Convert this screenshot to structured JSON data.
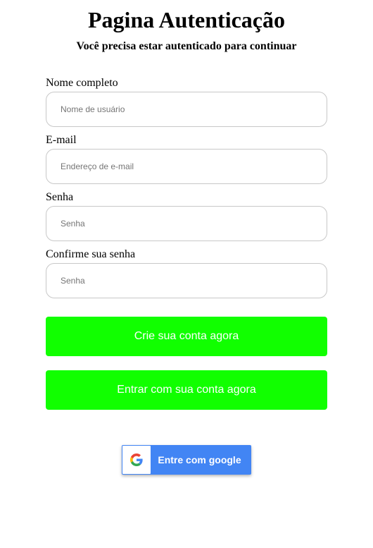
{
  "header": {
    "title": "Pagina Autenticação",
    "subtitle": "Você precisa estar autenticado para continuar"
  },
  "form": {
    "fields": [
      {
        "label": "Nome completo",
        "placeholder": "Nome de usuário",
        "value": ""
      },
      {
        "label": "E-mail",
        "placeholder": "Endereço de e-mail",
        "value": ""
      },
      {
        "label": "Senha",
        "placeholder": "Senha",
        "value": ""
      },
      {
        "label": "Confirme sua senha",
        "placeholder": "Senha",
        "value": ""
      }
    ]
  },
  "actions": {
    "create_account_label": "Crie sua conta agora",
    "login_label": "Entrar com sua conta agora",
    "google_label": "Entre com google",
    "google_icon": "google-g-icon"
  },
  "colors": {
    "primary_button": "#11ff00",
    "google_blue": "#4285f4"
  }
}
